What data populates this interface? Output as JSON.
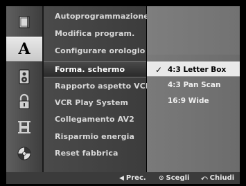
{
  "sidebar": {
    "icons": [
      {
        "name": "disc-icon",
        "glyph": "▯"
      },
      {
        "name": "language-icon",
        "glyph": "A"
      },
      {
        "name": "audio-icon",
        "glyph": "◉"
      },
      {
        "name": "lock-icon",
        "glyph": "🔒"
      },
      {
        "name": "film-icon",
        "glyph": "H"
      },
      {
        "name": "disc-settings-icon",
        "glyph": "◍"
      }
    ],
    "active_index": 1
  },
  "menu": {
    "items": [
      {
        "label": "Autoprogrammazione"
      },
      {
        "label": "Modifica program."
      },
      {
        "label": "Configurare orologio"
      },
      {
        "label": "Forma. schermo"
      },
      {
        "label": "Rapporto aspetto VCR"
      },
      {
        "label": "VCR Play System"
      },
      {
        "label": "Collegamento AV2"
      },
      {
        "label": "Risparmio energia"
      },
      {
        "label": "Reset fabbrica"
      }
    ],
    "selected_index": 3
  },
  "options": {
    "items": [
      {
        "label": "4:3 Letter Box"
      },
      {
        "label": "4:3 Pan Scan"
      },
      {
        "label": "16:9 Wide"
      }
    ],
    "selected_index": 0,
    "check_glyph": "✓"
  },
  "footer": {
    "prev": {
      "glyph": "◀",
      "label": "Prec."
    },
    "select": {
      "glyph": "⊙",
      "label": "Scegli"
    },
    "close": {
      "glyph": "⤺",
      "label": "Chiudi"
    }
  }
}
